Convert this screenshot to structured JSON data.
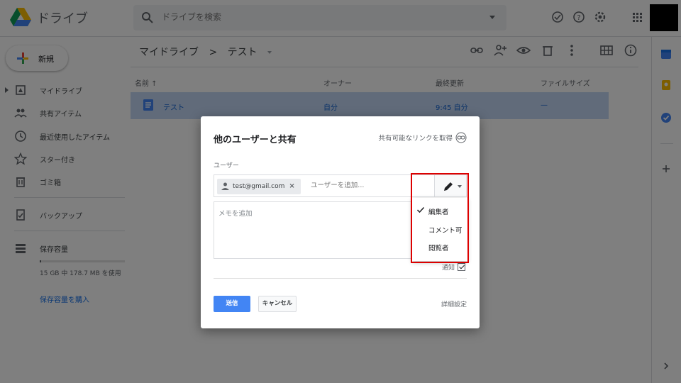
{
  "app": {
    "title": "ドライブ"
  },
  "search": {
    "placeholder": "ドライブを検索"
  },
  "sidebar": {
    "new_label": "新規",
    "items": [
      {
        "label": "マイドライブ",
        "icon": "drive-icon"
      },
      {
        "label": "共有アイテム",
        "icon": "shared-icon"
      },
      {
        "label": "最近使用したアイテム",
        "icon": "clock-icon"
      },
      {
        "label": "スター付き",
        "icon": "star-icon"
      },
      {
        "label": "ゴミ箱",
        "icon": "trash-icon"
      },
      {
        "label": "バックアップ",
        "icon": "backup-icon"
      },
      {
        "label": "保存容量",
        "icon": "storage-icon"
      }
    ],
    "storage_text": "15 GB 中 178.7 MB を使用",
    "storage_used_fraction": 0.012,
    "buy_storage": "保存容量を購入"
  },
  "main": {
    "breadcrumb": [
      "マイドライブ",
      "テスト"
    ],
    "breadcrumb_sep": ">",
    "columns": {
      "name": "名前 ↑",
      "owner": "オーナー",
      "modified": "最終更新",
      "size": "ファイルサイズ"
    },
    "row": {
      "name": "テスト",
      "owner": "自分",
      "modified": "9:45 自分",
      "size": "—"
    }
  },
  "dialog": {
    "title": "他のユーザーと共有",
    "link_label": "共有可能なリンクを取得",
    "users_label": "ユーザー",
    "chip_email": "test@gmail.com",
    "chip_remove": "×",
    "add_user_placeholder": "ユーザーを追加...",
    "memo_placeholder": "メモを追加",
    "notify_label": "通知",
    "send_label": "送信",
    "cancel_label": "キャンセル",
    "advanced_label": "詳細設定"
  },
  "permission_menu": {
    "selected": "編集者",
    "items": [
      "編集者",
      "コメント可",
      "閲覧者"
    ]
  },
  "colors": {
    "accent": "#4285f4",
    "highlight": "#dd0000",
    "selected_row": "#c2d7f4"
  }
}
